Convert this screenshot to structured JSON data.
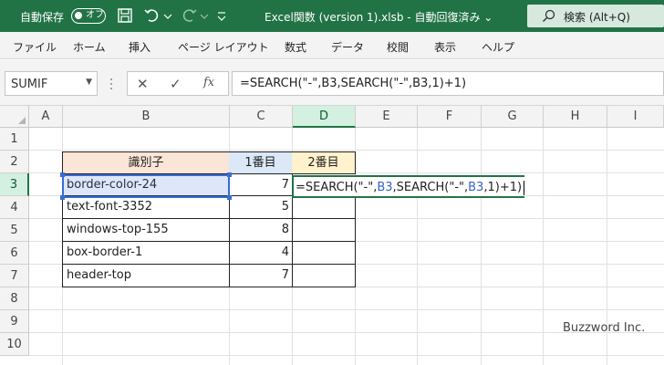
{
  "titlebar": {
    "autosave_label": "自動保存",
    "autosave_state": "オフ",
    "filename": "Excel関数 (version 1).xlsb  -  自動回復済み  ⌄",
    "search_label": "検索 (Alt+Q)"
  },
  "menu": [
    "ファイル",
    "ホーム",
    "挿入",
    "ページ レイアウト",
    "数式",
    "データ",
    "校閲",
    "表示",
    "ヘルプ"
  ],
  "formula_bar": {
    "name_box": "SUMIF",
    "fx_label": "fx",
    "formula": "=SEARCH(\"-\",B3,SEARCH(\"-\",B3,1)+1)"
  },
  "columns": [
    "A",
    "B",
    "C",
    "D",
    "E",
    "F",
    "G",
    "H",
    "I"
  ],
  "rows": [
    "1",
    "2",
    "3",
    "4",
    "5",
    "6",
    "7",
    "8",
    "9",
    "10"
  ],
  "table": {
    "headers": {
      "b": "識別子",
      "c": "1番目",
      "d": "2番目"
    },
    "rows": [
      {
        "b": "border-color-24",
        "c": "7"
      },
      {
        "b": "text-font-3352",
        "c": "5"
      },
      {
        "b": "windows-top-155",
        "c": "8"
      },
      {
        "b": "box-border-1",
        "c": "4"
      },
      {
        "b": "header-top",
        "c": "7"
      }
    ]
  },
  "editing": {
    "p1": "=SEARCH(\"-\",",
    "r1": "B3",
    "p2": ",SEARCH(\"-\",",
    "r2": "B3",
    "p3": ",1)+1)"
  },
  "watermark": "Buzzword Inc.",
  "colors": {
    "accent": "#217346",
    "header_b_fill": "#fbe5d6",
    "header_c_fill": "#dae8f8",
    "header_d_fill": "#fff2cc",
    "ref_blue": "#3465c4",
    "ref_purple": "#8b3fc9"
  }
}
